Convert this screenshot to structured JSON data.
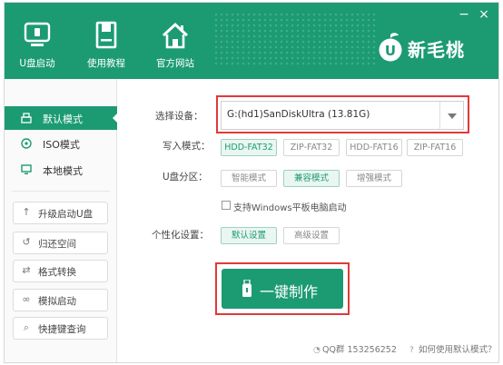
{
  "colors": {
    "accent": "#1c9b73",
    "highlight": "#e03a3a"
  },
  "header": {
    "nav": [
      {
        "label": "U盘启动",
        "icon": "usb-monitor-icon"
      },
      {
        "label": "使用教程",
        "icon": "book-icon"
      },
      {
        "label": "官方网站",
        "icon": "home-icon"
      }
    ],
    "window_controls": {
      "minimize": "−",
      "close": "×"
    },
    "brand": {
      "logo_letter": "U",
      "name": "新毛桃"
    }
  },
  "sidebar": {
    "modes": [
      {
        "label": "默认模式",
        "icon": "usb-drive-icon",
        "active": true
      },
      {
        "label": "ISO模式",
        "icon": "disc-icon",
        "active": false
      },
      {
        "label": "本地模式",
        "icon": "monitor-icon",
        "active": false
      }
    ],
    "tools": [
      {
        "label": "升级启动U盘",
        "icon": "arrow-up-icon",
        "glyph": "↑"
      },
      {
        "label": "归还空间",
        "icon": "restore-icon",
        "glyph": "↺"
      },
      {
        "label": "格式转换",
        "icon": "swap-icon",
        "glyph": "⇄"
      },
      {
        "label": "模拟启动",
        "icon": "link-icon",
        "glyph": "∞"
      },
      {
        "label": "快捷键查询",
        "icon": "search-icon",
        "glyph": "⌕"
      }
    ]
  },
  "main": {
    "device": {
      "label": "选择设备：",
      "value": "G:(hd1)SanDiskUltra (13.81G)"
    },
    "write_mode": {
      "label": "写入模式：",
      "options": [
        "HDD-FAT32",
        "ZIP-FAT32",
        "HDD-FAT16",
        "ZIP-FAT16"
      ],
      "selected": "HDD-FAT32"
    },
    "partition": {
      "label": "U盘分区：",
      "options": [
        "智能模式",
        "兼容模式",
        "增强模式"
      ],
      "selected": "兼容模式"
    },
    "windows_tablet": {
      "label": "支持Windows平板电脑启动",
      "checked": false
    },
    "customize": {
      "label": "个性化设置：",
      "options": [
        "默认设置",
        "高级设置"
      ],
      "selected": "默认设置"
    },
    "make_button": {
      "label": "一键制作"
    }
  },
  "footer": {
    "qq": "QQ群 153256252",
    "help": "如何使用默认模式？"
  }
}
